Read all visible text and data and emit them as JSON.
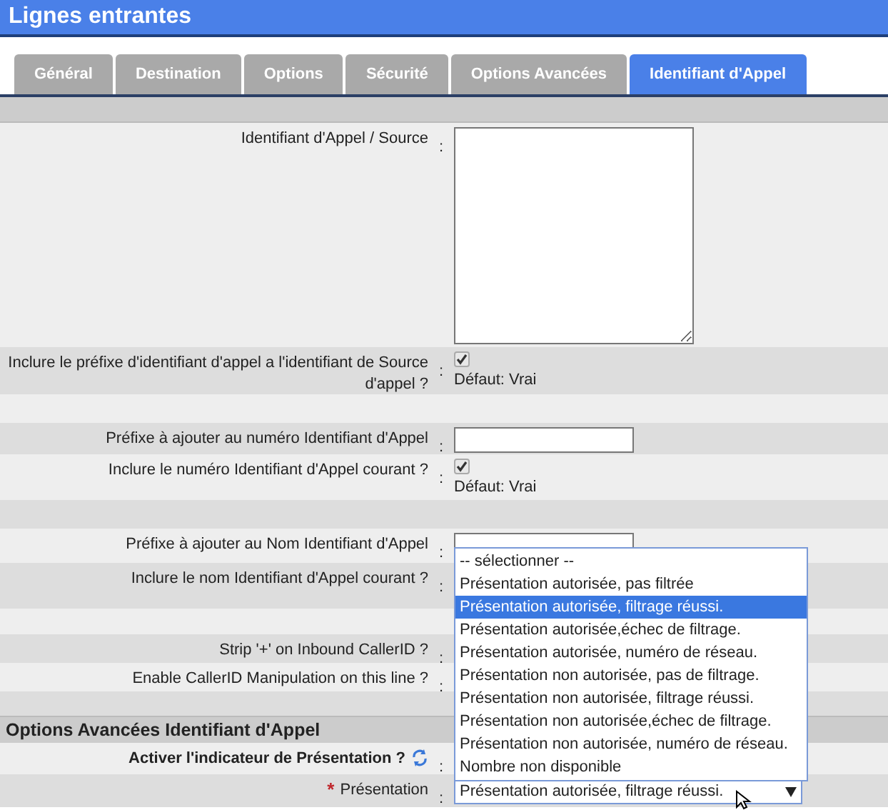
{
  "header": {
    "title": "Lignes entrantes"
  },
  "tabs": [
    {
      "label": "Général",
      "selected": false
    },
    {
      "label": "Destination",
      "selected": false
    },
    {
      "label": "Options",
      "selected": false
    },
    {
      "label": "Sécurité",
      "selected": false
    },
    {
      "label": "Options Avancées",
      "selected": false
    },
    {
      "label": "Identifiant d'Appel",
      "selected": true
    }
  ],
  "rows": [
    {
      "kind": "textarea",
      "label": "Identifiant d'Appel / Source"
    },
    {
      "kind": "checkbox",
      "label": "Inclure le préfixe d'identifiant d'appel a l'identifiant de Source d'appel ?",
      "checked": true,
      "default": "Défaut: Vrai"
    },
    {
      "kind": "empty"
    },
    {
      "kind": "input",
      "label": "Préfixe à ajouter au numéro Identifiant d'Appel"
    },
    {
      "kind": "checkbox",
      "label": "Inclure le numéro Identifiant d'Appel courant ?",
      "checked": true,
      "default": "Défaut: Vrai"
    },
    {
      "kind": "empty"
    },
    {
      "kind": "input",
      "label": "Préfixe à ajouter au Nom Identifiant d'Appel"
    },
    {
      "kind": "label",
      "label": "Inclure le nom Identifiant d'Appel courant ?"
    },
    {
      "kind": "empty"
    },
    {
      "kind": "label",
      "label": "Strip '+' on Inbound CallerID ?"
    },
    {
      "kind": "label",
      "label": "Enable CallerID Manipulation on this line ?"
    },
    {
      "kind": "empty"
    },
    {
      "kind": "section",
      "label": "Options Avancées Identifiant d'Appel"
    },
    {
      "kind": "refresh",
      "label": "Activer l'indicateur de Présentation ?"
    },
    {
      "kind": "select",
      "label": "Présentation",
      "required_mark": "*",
      "value": "Présentation autorisée, filtrage réussi."
    }
  ],
  "separator": ":",
  "dropdown": [
    {
      "label": "-- sélectionner --",
      "selected": false
    },
    {
      "label": "Présentation autorisée, pas filtrée",
      "selected": false
    },
    {
      "label": "Présentation autorisée, filtrage réussi.",
      "selected": true
    },
    {
      "label": "Présentation autorisée,échec de filtrage.",
      "selected": false
    },
    {
      "label": "Présentation autorisée, numéro de réseau.",
      "selected": false
    },
    {
      "label": "Présentation non autorisée, pas de filtrage.",
      "selected": false
    },
    {
      "label": "Présentation non autorisée, filtrage réussi.",
      "selected": false
    },
    {
      "label": "Présentation non autorisée,échec de filtrage.",
      "selected": false
    },
    {
      "label": "Présentation non autorisée, numéro de réseau.",
      "selected": false
    },
    {
      "label": "Nombre non disponible",
      "selected": false
    }
  ]
}
